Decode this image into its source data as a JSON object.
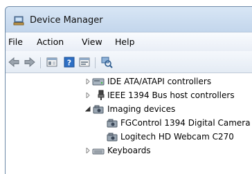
{
  "window": {
    "title": "Device Manager"
  },
  "menu": {
    "items": [
      "File",
      "Action",
      "View",
      "Help"
    ]
  },
  "toolbar": {
    "buttons": [
      "back-arrow-icon",
      "forward-arrow-icon",
      "properties-icon",
      "help-icon",
      "update-driver-icon",
      "scan-hardware-icon"
    ]
  },
  "tree": {
    "items": [
      {
        "label": "IDE ATA/ATAPI controllers",
        "icon": "ide-controller-icon",
        "state": "collapsed"
      },
      {
        "label": "IEEE 1394 Bus host controllers",
        "icon": "firewire-icon",
        "state": "collapsed"
      },
      {
        "label": "Imaging devices",
        "icon": "imaging-device-icon",
        "state": "expanded"
      },
      {
        "label": "FGControl 1394 Digital Camera",
        "icon": "camera-icon",
        "state": "leaf"
      },
      {
        "label": "Logitech HD Webcam C270",
        "icon": "camera-icon",
        "state": "leaf"
      },
      {
        "label": "Keyboards",
        "icon": "keyboard-icon",
        "state": "collapsed"
      }
    ]
  },
  "colors": {
    "titlebar": "#c9daee",
    "menubar": "#f3f6fb"
  }
}
